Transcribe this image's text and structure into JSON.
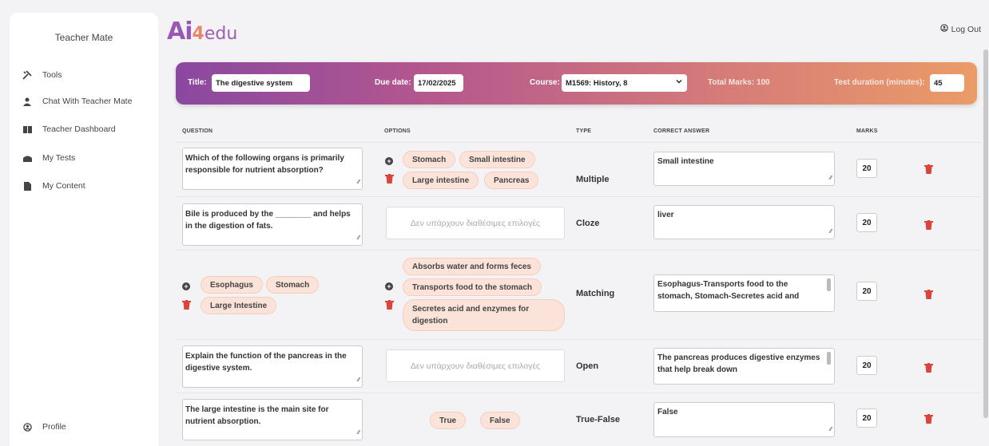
{
  "sidebar": {
    "title": "Teacher Mate",
    "items": [
      {
        "label": "Tools",
        "icon": "tools-icon"
      },
      {
        "label": "Chat With Teacher Mate",
        "icon": "person-icon"
      },
      {
        "label": "Teacher Dashboard",
        "icon": "book-icon"
      },
      {
        "label": "My Tests",
        "icon": "hat-icon"
      },
      {
        "label": "My Content",
        "icon": "file-icon"
      }
    ],
    "profile": "Profile"
  },
  "header": {
    "logo_main": "Ai",
    "logo_num": "4",
    "logo_tail": "edu",
    "logout": "Log Out"
  },
  "test": {
    "title_label": "Title:",
    "title_value": "The digestive system",
    "due_label": "Due date:",
    "due_value": "17/02/2025",
    "course_label": "Course:",
    "course_value": "M1569: History, 8",
    "total_marks": "Total Marks:  100",
    "duration_label": "Test duration (minutes):",
    "duration_value": "45"
  },
  "columns": [
    "QUESTION",
    "OPTIONS",
    "TYPE",
    "CORRECT ANSWER",
    "MARKS"
  ],
  "rows": [
    {
      "question": "Which of the following organs is primarily responsible for nutrient absorption?",
      "options": [
        "Stomach",
        "Small intestine",
        "Large intestine",
        "Pancreas"
      ],
      "type": "Multiple",
      "answer": "Small intestine",
      "marks": "20"
    },
    {
      "question": "Bile is produced by the ________ and helps in the digestion of fats.",
      "no_options": "Δεν υπάρχουν διαθέσιμες επιλογές",
      "type": "Cloze",
      "answer": "liver",
      "marks": "20"
    },
    {
      "left_items": [
        "Esophagus",
        "Stomach",
        "Large Intestine"
      ],
      "options": [
        "Absorbs water and forms feces",
        "Transports food to the stomach",
        "Secretes acid and enzymes for digestion"
      ],
      "type": "Matching",
      "answer": "Esophagus-Transports food to the stomach, Stomach-Secretes acid and",
      "marks": "20"
    },
    {
      "question": "Explain the function of the pancreas in the digestive system.",
      "no_options": "Δεν υπάρχουν διαθέσιμες επιλογές",
      "type": "Open",
      "answer": "The pancreas produces digestive enzymes that help break down",
      "marks": "20"
    },
    {
      "question": "The large intestine is the main site for nutrient absorption.",
      "options": [
        "True",
        "False"
      ],
      "type": "True-False",
      "answer": "False",
      "marks": "20"
    }
  ],
  "colors": {
    "banner_start": "#8a48a0",
    "banner_end": "#eb9c67",
    "chip_bg": "#fbe3d9",
    "delete": "#d9443c"
  }
}
